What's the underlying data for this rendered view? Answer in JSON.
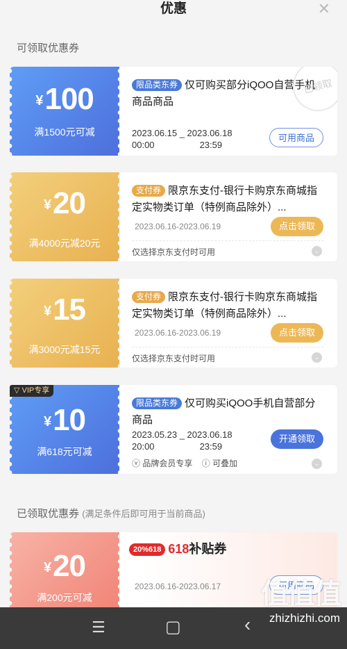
{
  "header": {
    "title": "优惠",
    "close_icon": "close-icon"
  },
  "sections": {
    "available": "可领取优惠券",
    "received": "已领取优惠券",
    "received_sub": "(满足条件后即可用于当前商品)"
  },
  "coupons": [
    {
      "yen": "¥",
      "amount": "100",
      "condition": "满1500元可减",
      "tag": "限品类东券",
      "desc": "仅可购买部分iQOO自营手机商品商品",
      "date_start": "2023.06.15",
      "date_end": "2023.06.18",
      "time_start": "00:00",
      "time_end": "23:59",
      "button": "可用商品",
      "stamp": "已领取"
    },
    {
      "yen": "¥",
      "amount": "20",
      "condition": "满4000元减20元",
      "tag": "支付券",
      "desc": "限京东支付-银行卡购京东商城指定实物类订单（特例商品除外）...",
      "date": "2023.06.16-2023.06.19",
      "button": "点击领取",
      "note": "仅选择京东支付时可用"
    },
    {
      "yen": "¥",
      "amount": "15",
      "condition": "满3000元减15元",
      "tag": "支付券",
      "desc": "限京东支付-银行卡购京东商城指定实物类订单（特例商品除外）...",
      "date": "2023.06.16-2023.06.19",
      "button": "点击领取",
      "note": "仅选择京东支付时可用"
    },
    {
      "vip": "VIP专享",
      "yen": "¥",
      "amount": "10",
      "condition": "满618元可减",
      "tag": "限品类东券",
      "desc": "仅可购买iQOO手机自营部分商品",
      "date_start": "2023.05.23",
      "date_end": "2023.06.18",
      "time_start": "20:00",
      "time_end": "23:59",
      "button": "开通领取",
      "note_1": "品牌会员专享",
      "note_2": "可叠加"
    },
    {
      "yen": "¥",
      "amount": "20",
      "condition": "满200元可减",
      "badge": "20%618",
      "title_618": "618",
      "title_sub": "补贴券",
      "date": "2023.06.16-2023.06.17",
      "button": "可用商品"
    }
  ],
  "navbar": {
    "menu_icon": "☰",
    "home_icon": "▢",
    "back_icon": "‹"
  },
  "watermark": {
    "logo": "值值值",
    "url": "zhizhizhi.com"
  }
}
